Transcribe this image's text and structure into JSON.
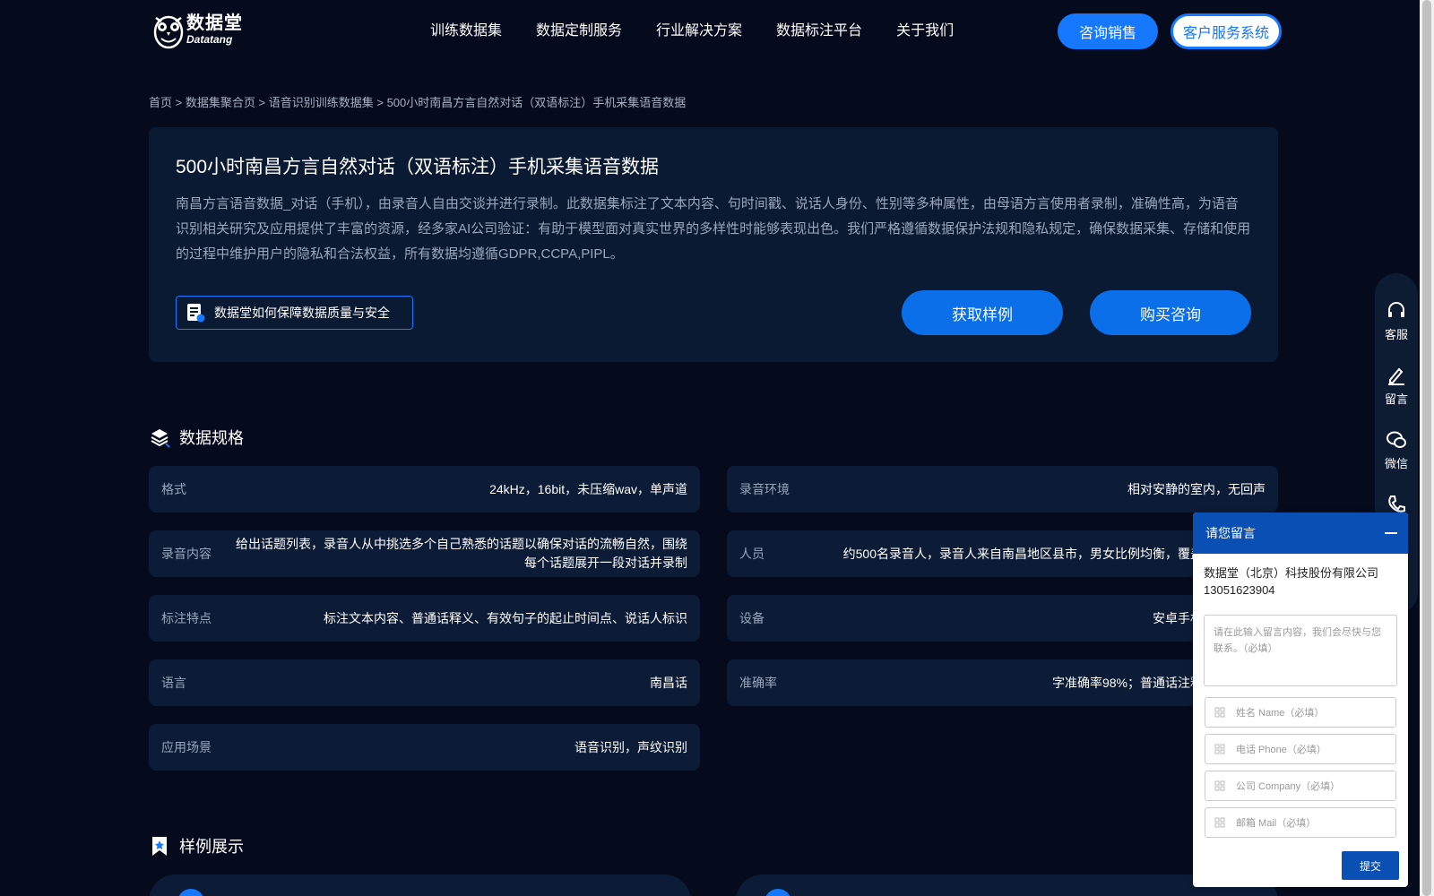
{
  "header": {
    "logo": {
      "cn": "数据堂",
      "en": "Datatang"
    },
    "nav": [
      "训练数据集",
      "数据定制服务",
      "行业解决方案",
      "数据标注平台",
      "关于我们"
    ],
    "sales_button": "咨询销售",
    "cs_button": "客户服务系统"
  },
  "breadcrumb": {
    "home": "首页",
    "sep": ">",
    "level1": "数据集聚合页",
    "level2": "语音识别训练数据集",
    "current": "500小时南昌方言自然对话（双语标注）手机采集语音数据"
  },
  "hero": {
    "title": "500小时南昌方言自然对话（双语标注）手机采集语音数据",
    "description": "南昌方言语音数据_对话（手机），由录音人自由交谈并进行录制。此数据集标注了文本内容、句时间戳、说话人身份、性别等多种属性，由母语方言使用者录制，准确性高，为语音识别相关研究及应用提供了丰富的资源，经多家AI公司验证：有助于模型面对真实世界的多样性时能够表现出色。我们严格遵循数据保护法规和隐私规定，确保数据采集、存储和使用的过程中维护用户的隐私和合法权益，所有数据均遵循GDPR,CCPA,PIPL。",
    "quality_link": "数据堂如何保障数据质量与安全",
    "sample_button": "获取样例",
    "buy_button": "购买咨询"
  },
  "specs": {
    "title": "数据规格",
    "left": [
      {
        "key": "格式",
        "value": "24kHz，16bit，未压缩wav，单声道"
      },
      {
        "key": "录音内容",
        "value": "给出话题列表，录音人从中挑选多个自己熟悉的话题以确保对话的流畅自然，围绕每个话题展开一段对话并录制"
      },
      {
        "key": "标注特点",
        "value": "标注文本内容、普通话释义、有效句子的起止时间点、说话人标识"
      },
      {
        "key": "语言",
        "value": "南昌话"
      },
      {
        "key": "应用场景",
        "value": "语音识别，声纹识别"
      }
    ],
    "right": [
      {
        "key": "录音环境",
        "value": "相对安静的室内，无回声"
      },
      {
        "key": "人员",
        "value": "约500名录音人，录音人来自南昌地区县市，男女比例均衡，覆盖"
      },
      {
        "key": "设备",
        "value": "安卓手机"
      },
      {
        "key": "准确率",
        "value": "字准确率98%；普通话注释"
      }
    ]
  },
  "samples": {
    "title": "样例展示"
  },
  "sidebar": [
    "客服",
    "留言",
    "微信"
  ],
  "message": {
    "title": "请您留言",
    "company": "数据堂（北京）科技股份有限公司",
    "phone": "13051623904",
    "textarea_placeholder": "请在此输入留言内容，我们会尽快与您联系。（必填）",
    "fields": [
      "姓名 Name（必填）",
      "电话 Phone（必填）",
      "公司 Company（必填）",
      "邮箱 Mail（必填）"
    ],
    "submit": "提交"
  }
}
